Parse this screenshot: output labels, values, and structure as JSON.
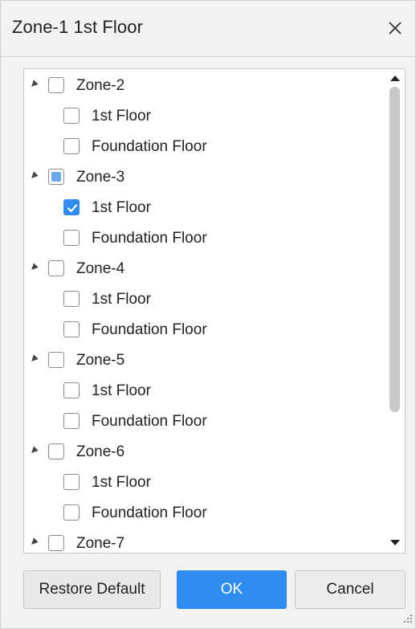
{
  "dialog": {
    "title": "Zone-1 1st Floor",
    "close_icon": "close-icon"
  },
  "tree": {
    "nodes": [
      {
        "label": "Zone-2",
        "state": "unchecked",
        "children": [
          {
            "label": "1st Floor",
            "state": "unchecked"
          },
          {
            "label": "Foundation Floor",
            "state": "unchecked"
          }
        ]
      },
      {
        "label": "Zone-3",
        "state": "partial",
        "children": [
          {
            "label": "1st Floor",
            "state": "checked"
          },
          {
            "label": "Foundation Floor",
            "state": "unchecked"
          }
        ]
      },
      {
        "label": "Zone-4",
        "state": "unchecked",
        "children": [
          {
            "label": "1st Floor",
            "state": "unchecked"
          },
          {
            "label": "Foundation Floor",
            "state": "unchecked"
          }
        ]
      },
      {
        "label": "Zone-5",
        "state": "unchecked",
        "children": [
          {
            "label": "1st Floor",
            "state": "unchecked"
          },
          {
            "label": "Foundation Floor",
            "state": "unchecked"
          }
        ]
      },
      {
        "label": "Zone-6",
        "state": "unchecked",
        "children": [
          {
            "label": "1st Floor",
            "state": "unchecked"
          },
          {
            "label": "Foundation Floor",
            "state": "unchecked"
          }
        ]
      },
      {
        "label": "Zone-7",
        "state": "unchecked",
        "children": []
      }
    ]
  },
  "buttons": {
    "restore_default": "Restore Default",
    "ok": "OK",
    "cancel": "Cancel"
  },
  "colors": {
    "accent": "#2f8cf0",
    "partial": "#6aa7ee"
  }
}
